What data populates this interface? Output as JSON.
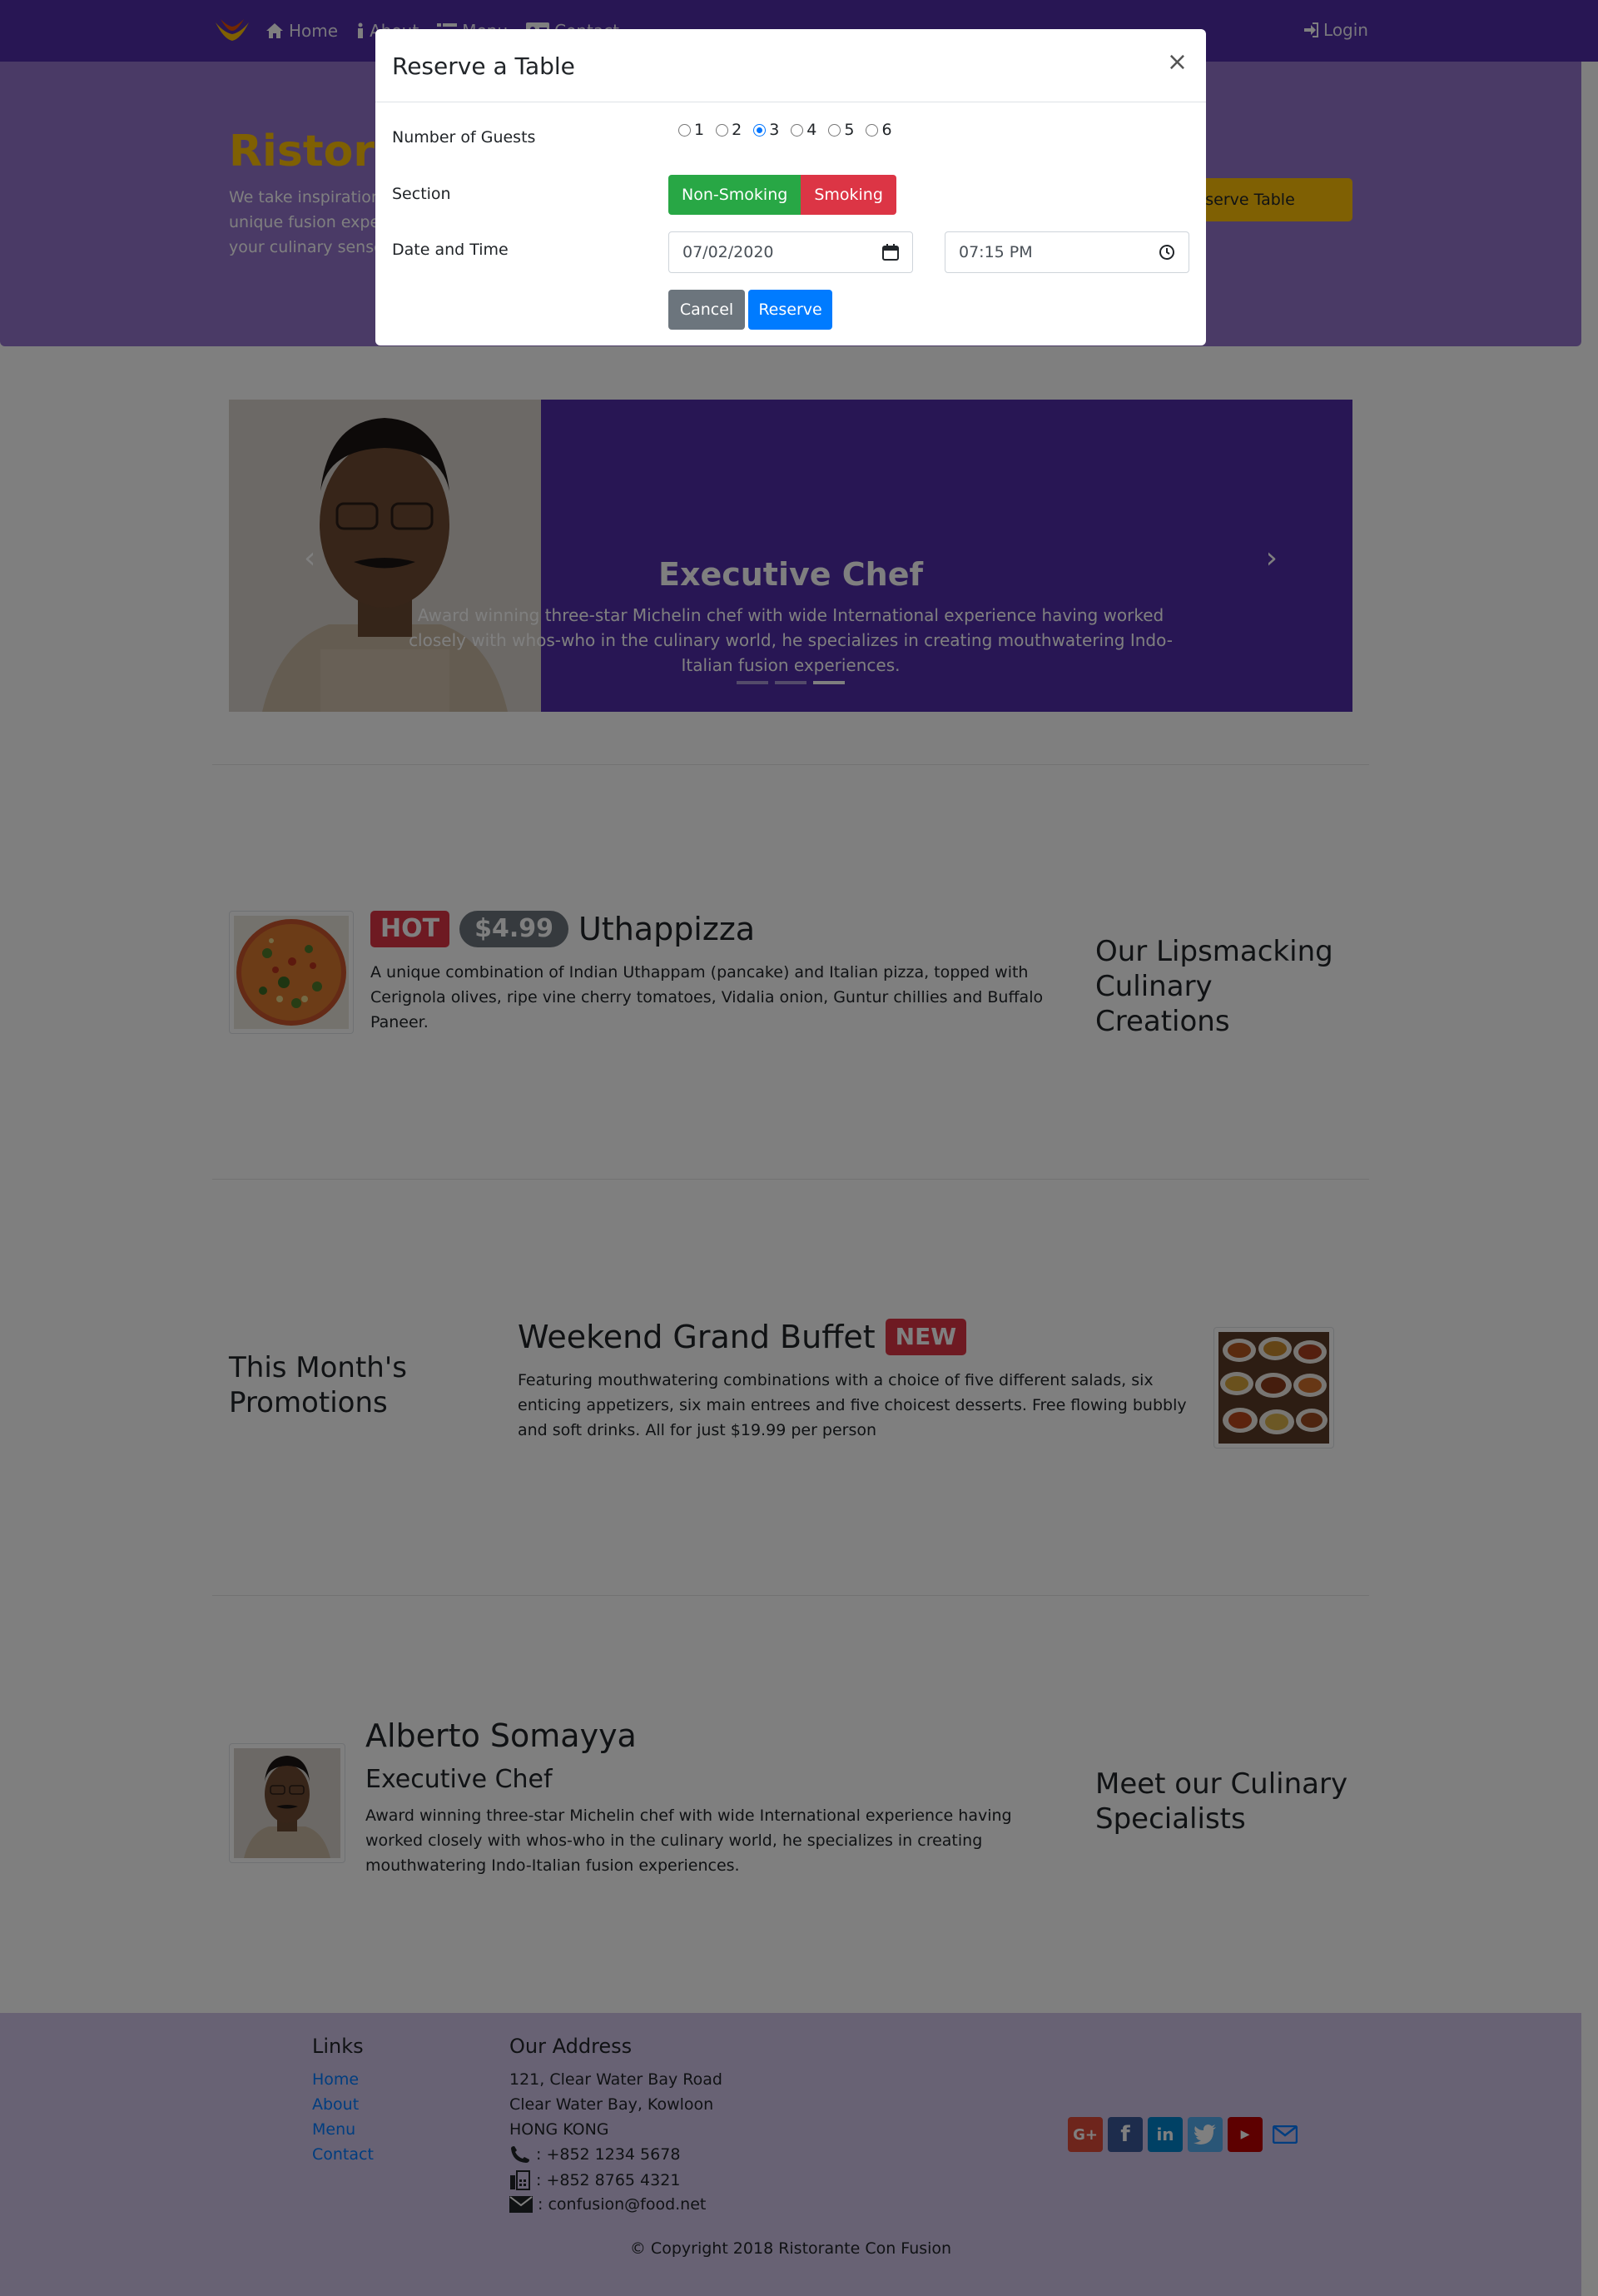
{
  "navbar": {
    "links": [
      {
        "label": "Home",
        "icon": "home-icon"
      },
      {
        "label": "About",
        "icon": "info-icon"
      },
      {
        "label": "Menu",
        "icon": "list-icon"
      },
      {
        "label": "Contact",
        "icon": "address-card-icon"
      }
    ],
    "login_label": "Login",
    "brand_color": "#512DA8"
  },
  "jumbotron": {
    "title": "Ristorante Con Fusion",
    "text": "We take inspiration from the World's best cuisines, and create a unique fusion experience. Our lipsmacking creations will tickle your culinary senses!",
    "reserve_button": "Reserve Table"
  },
  "carousel": {
    "title": "Executive Chef",
    "text": "Award winning three-star Michelin chef with wide International experience having worked closely with whos-who in the culinary world, he specializes in creating mouthwatering Indo-Italian fusion experiences.",
    "indicator_count": 3,
    "active_indicator": 3
  },
  "dish": {
    "badge_hot": "HOT",
    "price": "$4.99",
    "name": "Uthappizza",
    "description": "A unique combination of Indian Uthappam (pancake) and Italian pizza, topped with Cerignola olives, ripe vine cherry tomatoes, Vidalia onion, Guntur chillies and Buffalo Paneer.",
    "section_title": "Our Lipsmacking Culinary Creations"
  },
  "promotion": {
    "section_title": "This Month's Promotions",
    "name": "Weekend Grand Buffet",
    "badge_new": "NEW",
    "description": "Featuring mouthwatering combinations with a choice of five different salads, six enticing appetizers, six main entrees and five choicest desserts. Free flowing bubbly and soft drinks. All for just $19.99 per person"
  },
  "leader": {
    "name": "Alberto Somayya",
    "designation": "Executive Chef",
    "description": "Award winning three-star Michelin chef with wide International experience having worked closely with whos-who in the culinary world, he specializes in creating mouthwatering Indo-Italian fusion experiences.",
    "section_title": "Meet our Culinary Specialists"
  },
  "footer": {
    "links_title": "Links",
    "links": [
      "Home",
      "About",
      "Menu",
      "Contact"
    ],
    "address_title": "Our Address",
    "address_lines": [
      "121, Clear Water Bay Road",
      "Clear Water Bay, Kowloon",
      "HONG KONG"
    ],
    "phone": ": +852 1234 5678",
    "fax": ": +852 8765 4321",
    "email_prefix": ": ",
    "email": "confusion@food.net",
    "social": [
      "google-plus-icon",
      "facebook-icon",
      "linkedin-icon",
      "twitter-icon",
      "youtube-icon",
      "envelope-icon"
    ],
    "copyright": "© Copyright 2018 Ristorante Con Fusion"
  },
  "modal": {
    "title": "Reserve a Table",
    "close": "×",
    "guests_label": "Number of Guests",
    "guest_options": [
      "1",
      "2",
      "3",
      "4",
      "5",
      "6"
    ],
    "guests_selected": "3",
    "section_label": "Section",
    "section_options": [
      "Non-Smoking",
      "Smoking"
    ],
    "datetime_label": "Date and Time",
    "date_value": "07/02/2020",
    "time_value": "07:15 PM",
    "cancel_label": "Cancel",
    "reserve_label": "Reserve"
  }
}
